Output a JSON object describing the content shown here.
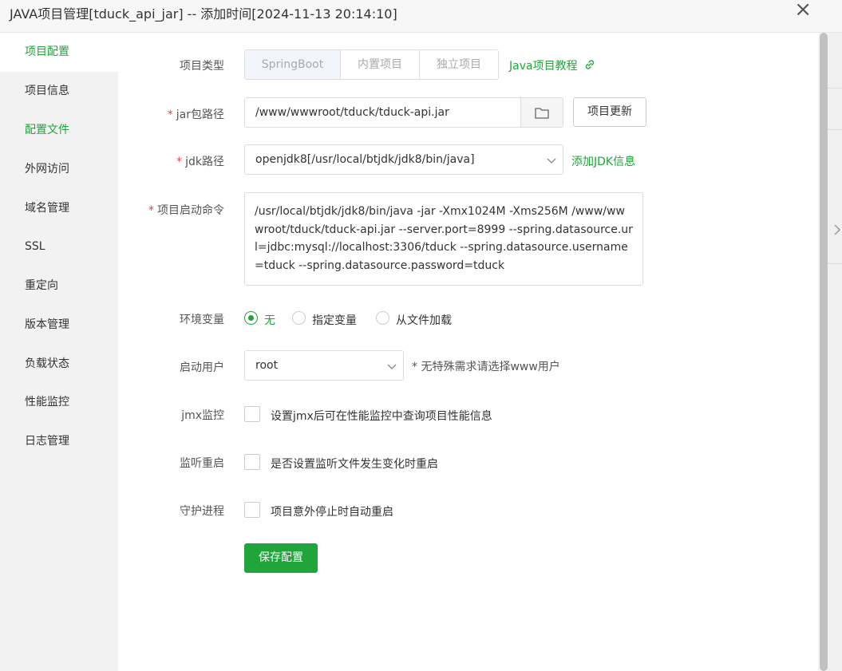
{
  "window": {
    "title": "JAVA项目管理[tduck_api_jar] -- 添加时间[2024-11-13 20:14:10]",
    "close_icon": "×"
  },
  "sidebar": {
    "items": [
      {
        "label": "项目配置",
        "active": true
      },
      {
        "label": "项目信息"
      },
      {
        "label": "配置文件"
      },
      {
        "label": "外网访问"
      },
      {
        "label": "域名管理"
      },
      {
        "label": "SSL"
      },
      {
        "label": "重定向"
      },
      {
        "label": "版本管理"
      },
      {
        "label": "负载状态"
      },
      {
        "label": "性能监控"
      },
      {
        "label": "日志管理"
      }
    ]
  },
  "form": {
    "project_type": {
      "label": "项目类型",
      "options": [
        "SpringBoot",
        "内置项目",
        "独立项目"
      ],
      "selected": "SpringBoot",
      "tutorial_link": "Java项目教程"
    },
    "jar_path": {
      "label": "jar包路径",
      "value": "/www/wwwroot/tduck/tduck-api.jar",
      "update_button": "项目更新"
    },
    "jdk_path": {
      "label": "jdk路径",
      "value": "openjdk8[/usr/local/btjdk/jdk8/bin/java]",
      "add_link": "添加JDK信息"
    },
    "start_command": {
      "label": "项目启动命令",
      "value": "/usr/local/btjdk/jdk8/bin/java -jar  -Xmx1024M -Xms256M /www/wwwroot/tduck/tduck-api.jar  --server.port=8999   --spring.datasource.url=jdbc:mysql://localhost:3306/tduck --spring.datasource.username=tduck --spring.datasource.password=tduck"
    },
    "env": {
      "label": "环境变量",
      "options": [
        "无",
        "指定变量",
        "从文件加载"
      ],
      "selected": "无"
    },
    "start_user": {
      "label": "启动用户",
      "value": "root",
      "hint": "* 无特殊需求请选择www用户"
    },
    "jmx": {
      "label": "jmx监控",
      "text": "设置jmx后可在性能监控中查询项目性能信息",
      "checked": false
    },
    "watch_restart": {
      "label": "监听重启",
      "text": "是否设置监听文件发生变化时重启",
      "checked": false
    },
    "daemon": {
      "label": "守护进程",
      "text": "项目意外停止时自动重启",
      "checked": false
    },
    "save_button": "保存配置"
  },
  "colors": {
    "accent": "#20a53a",
    "required": "#e64545"
  }
}
